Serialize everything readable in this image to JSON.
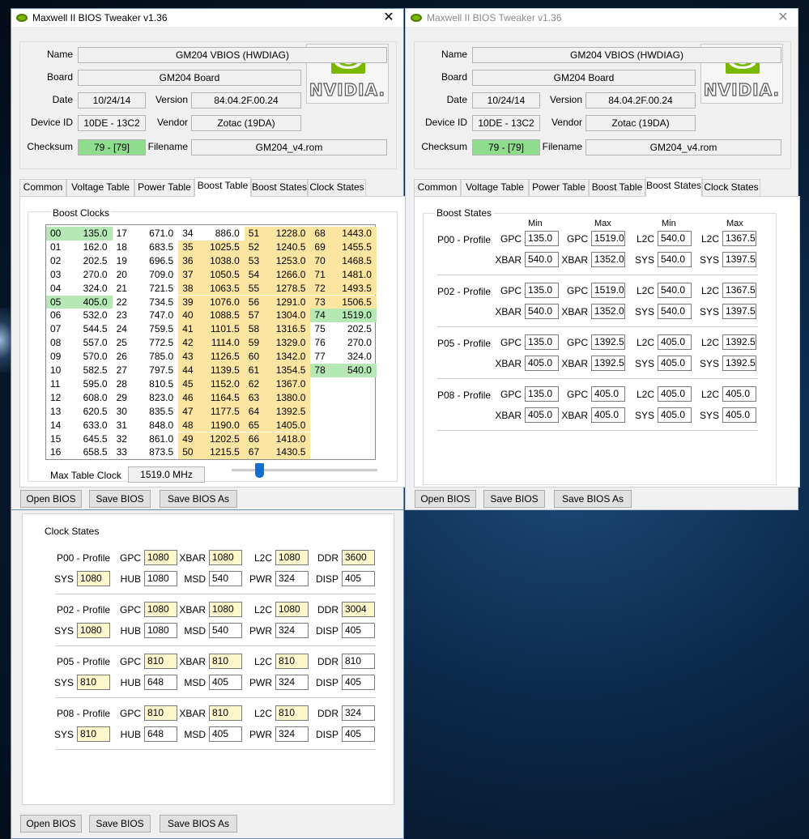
{
  "window_title": "Maxwell II BIOS Tweaker v1.36",
  "close_glyph": "✕",
  "logo_text": "NVIDIA.",
  "info": {
    "name_label": "Name",
    "name_value": "GM204 VBIOS (HWDIAG)",
    "board_label": "Board",
    "board_value": "GM204 Board",
    "date_label": "Date",
    "date_value": "10/24/14",
    "version_label": "Version",
    "version_value": "84.04.2F.00.24",
    "device_label": "Device ID",
    "device_value": "10DE - 13C2",
    "vendor_label": "Vendor",
    "vendor_value": "Zotac (19DA)",
    "checksum_label": "Checksum",
    "checksum_value": "79 - [79]",
    "filename_label": "Filename",
    "filename_value": "GM204_v4.rom"
  },
  "tabs": [
    "Common",
    "Voltage Table",
    "Power Table",
    "Boost Table",
    "Boost States",
    "Clock States"
  ],
  "buttons": {
    "open": "Open BIOS",
    "save": "Save BIOS",
    "save_as": "Save BIOS As"
  },
  "boost_table": {
    "group_title": "Boost Clocks",
    "max_label": "Max Table Clock",
    "max_value": "1519.0 MHz",
    "slider_fraction": 0.19,
    "columns": [
      [
        [
          "00",
          "135.0",
          "g"
        ],
        [
          "01",
          "162.0",
          ""
        ],
        [
          "02",
          "202.5",
          ""
        ],
        [
          "03",
          "270.0",
          ""
        ],
        [
          "04",
          "324.0",
          ""
        ],
        [
          "05",
          "405.0",
          "g"
        ],
        [
          "06",
          "532.0",
          ""
        ],
        [
          "07",
          "544.5",
          ""
        ],
        [
          "08",
          "557.0",
          ""
        ],
        [
          "09",
          "570.0",
          ""
        ],
        [
          "10",
          "582.5",
          ""
        ],
        [
          "11",
          "595.0",
          ""
        ],
        [
          "12",
          "608.0",
          ""
        ],
        [
          "13",
          "620.5",
          ""
        ],
        [
          "14",
          "633.0",
          ""
        ],
        [
          "15",
          "645.5",
          ""
        ],
        [
          "16",
          "658.5",
          ""
        ]
      ],
      [
        [
          "17",
          "671.0",
          ""
        ],
        [
          "18",
          "683.5",
          ""
        ],
        [
          "19",
          "696.5",
          ""
        ],
        [
          "20",
          "709.0",
          ""
        ],
        [
          "21",
          "721.5",
          ""
        ],
        [
          "22",
          "734.5",
          ""
        ],
        [
          "23",
          "747.0",
          ""
        ],
        [
          "24",
          "759.5",
          ""
        ],
        [
          "25",
          "772.5",
          ""
        ],
        [
          "26",
          "785.0",
          ""
        ],
        [
          "27",
          "797.5",
          ""
        ],
        [
          "28",
          "810.5",
          ""
        ],
        [
          "29",
          "823.0",
          ""
        ],
        [
          "30",
          "835.5",
          ""
        ],
        [
          "31",
          "848.0",
          ""
        ],
        [
          "32",
          "861.0",
          ""
        ],
        [
          "33",
          "873.5",
          ""
        ]
      ],
      [
        [
          "34",
          "886.0",
          ""
        ],
        [
          "35",
          "1025.5",
          "y"
        ],
        [
          "36",
          "1038.0",
          "y"
        ],
        [
          "37",
          "1050.5",
          "y"
        ],
        [
          "38",
          "1063.5",
          "y"
        ],
        [
          "39",
          "1076.0",
          "y"
        ],
        [
          "40",
          "1088.5",
          "y"
        ],
        [
          "41",
          "1101.5",
          "y"
        ],
        [
          "42",
          "1114.0",
          "y"
        ],
        [
          "43",
          "1126.5",
          "y"
        ],
        [
          "44",
          "1139.5",
          "y"
        ],
        [
          "45",
          "1152.0",
          "y"
        ],
        [
          "46",
          "1164.5",
          "y"
        ],
        [
          "47",
          "1177.5",
          "y"
        ],
        [
          "48",
          "1190.0",
          "y"
        ],
        [
          "49",
          "1202.5",
          "y"
        ],
        [
          "50",
          "1215.5",
          "y"
        ]
      ],
      [
        [
          "51",
          "1228.0",
          "y"
        ],
        [
          "52",
          "1240.5",
          "y"
        ],
        [
          "53",
          "1253.0",
          "y"
        ],
        [
          "54",
          "1266.0",
          "y"
        ],
        [
          "55",
          "1278.5",
          "y"
        ],
        [
          "56",
          "1291.0",
          "y"
        ],
        [
          "57",
          "1304.0",
          "y"
        ],
        [
          "58",
          "1316.5",
          "y"
        ],
        [
          "59",
          "1329.0",
          "y"
        ],
        [
          "60",
          "1342.0",
          "y"
        ],
        [
          "61",
          "1354.5",
          "y"
        ],
        [
          "62",
          "1367.0",
          "y"
        ],
        [
          "63",
          "1380.0",
          "y"
        ],
        [
          "64",
          "1392.5",
          "y"
        ],
        [
          "65",
          "1405.0",
          "y"
        ],
        [
          "66",
          "1418.0",
          "y"
        ],
        [
          "67",
          "1430.5",
          "y"
        ]
      ],
      [
        [
          "68",
          "1443.0",
          "y"
        ],
        [
          "69",
          "1455.5",
          "y"
        ],
        [
          "70",
          "1468.5",
          "y"
        ],
        [
          "71",
          "1481.0",
          "y"
        ],
        [
          "72",
          "1493.5",
          "y"
        ],
        [
          "73",
          "1506.5",
          "y"
        ],
        [
          "74",
          "1519.0",
          "g"
        ],
        [
          "75",
          "202.5",
          ""
        ],
        [
          "76",
          "270.0",
          ""
        ],
        [
          "77",
          "324.0",
          ""
        ],
        [
          "78",
          "540.0",
          "g"
        ]
      ]
    ]
  },
  "boost_states": {
    "group_title": "Boost States",
    "headers": [
      "Min",
      "Max",
      "Min",
      "Max"
    ],
    "profiles": [
      {
        "name": "P00 - Profile",
        "row1": [
          [
            "GPC",
            "135.0"
          ],
          [
            "GPC",
            "1519.0"
          ],
          [
            "L2C",
            "540.0"
          ],
          [
            "L2C",
            "1367.5"
          ]
        ],
        "row2": [
          [
            "XBAR",
            "540.0"
          ],
          [
            "XBAR",
            "1352.0"
          ],
          [
            "SYS",
            "540.0"
          ],
          [
            "SYS",
            "1397.5"
          ]
        ]
      },
      {
        "name": "P02 - Profile",
        "row1": [
          [
            "GPC",
            "135.0"
          ],
          [
            "GPC",
            "1519.0"
          ],
          [
            "L2C",
            "540.0"
          ],
          [
            "L2C",
            "1367.5"
          ]
        ],
        "row2": [
          [
            "XBAR",
            "540.0"
          ],
          [
            "XBAR",
            "1352.0"
          ],
          [
            "SYS",
            "540.0"
          ],
          [
            "SYS",
            "1397.5"
          ]
        ]
      },
      {
        "name": "P05 - Profile",
        "row1": [
          [
            "GPC",
            "135.0"
          ],
          [
            "GPC",
            "1392.5"
          ],
          [
            "L2C",
            "405.0"
          ],
          [
            "L2C",
            "1392.5"
          ]
        ],
        "row2": [
          [
            "XBAR",
            "405.0"
          ],
          [
            "XBAR",
            "1392.5"
          ],
          [
            "SYS",
            "405.0"
          ],
          [
            "SYS",
            "1392.5"
          ]
        ]
      },
      {
        "name": "P08 - Profile",
        "row1": [
          [
            "GPC",
            "135.0"
          ],
          [
            "GPC",
            "405.0"
          ],
          [
            "L2C",
            "405.0"
          ],
          [
            "L2C",
            "405.0"
          ]
        ],
        "row2": [
          [
            "XBAR",
            "405.0"
          ],
          [
            "XBAR",
            "405.0"
          ],
          [
            "SYS",
            "405.0"
          ],
          [
            "SYS",
            "405.0"
          ]
        ]
      }
    ]
  },
  "clock_states": {
    "group_title": "Clock States",
    "profiles": [
      {
        "name": "P00 - Profile",
        "row1": [
          [
            "GPC",
            "1080",
            "y"
          ],
          [
            "XBAR",
            "1080",
            "y"
          ],
          [
            "L2C",
            "1080",
            "y"
          ],
          [
            "DDR",
            "3600",
            "y"
          ]
        ],
        "row2": [
          [
            "SYS",
            "1080",
            "y"
          ],
          [
            "HUB",
            "1080",
            ""
          ],
          [
            "MSD",
            "540",
            ""
          ],
          [
            "PWR",
            "324",
            ""
          ],
          [
            "DISP",
            "405",
            ""
          ]
        ]
      },
      {
        "name": "P02 - Profile",
        "row1": [
          [
            "GPC",
            "1080",
            "y"
          ],
          [
            "XBAR",
            "1080",
            "y"
          ],
          [
            "L2C",
            "1080",
            "y"
          ],
          [
            "DDR",
            "3004",
            "y"
          ]
        ],
        "row2": [
          [
            "SYS",
            "1080",
            "y"
          ],
          [
            "HUB",
            "1080",
            ""
          ],
          [
            "MSD",
            "540",
            ""
          ],
          [
            "PWR",
            "324",
            ""
          ],
          [
            "DISP",
            "405",
            ""
          ]
        ]
      },
      {
        "name": "P05 - Profile",
        "row1": [
          [
            "GPC",
            "810",
            "y"
          ],
          [
            "XBAR",
            "810",
            "y"
          ],
          [
            "L2C",
            "810",
            "y"
          ],
          [
            "DDR",
            "810",
            ""
          ]
        ],
        "row2": [
          [
            "SYS",
            "810",
            "y"
          ],
          [
            "HUB",
            "648",
            ""
          ],
          [
            "MSD",
            "405",
            ""
          ],
          [
            "PWR",
            "324",
            ""
          ],
          [
            "DISP",
            "405",
            ""
          ]
        ]
      },
      {
        "name": "P08 - Profile",
        "row1": [
          [
            "GPC",
            "810",
            "y"
          ],
          [
            "XBAR",
            "810",
            "y"
          ],
          [
            "L2C",
            "810",
            "y"
          ],
          [
            "DDR",
            "324",
            ""
          ]
        ],
        "row2": [
          [
            "SYS",
            "810",
            "y"
          ],
          [
            "HUB",
            "648",
            ""
          ],
          [
            "MSD",
            "405",
            ""
          ],
          [
            "PWR",
            "324",
            ""
          ],
          [
            "DISP",
            "405",
            ""
          ]
        ]
      }
    ]
  }
}
